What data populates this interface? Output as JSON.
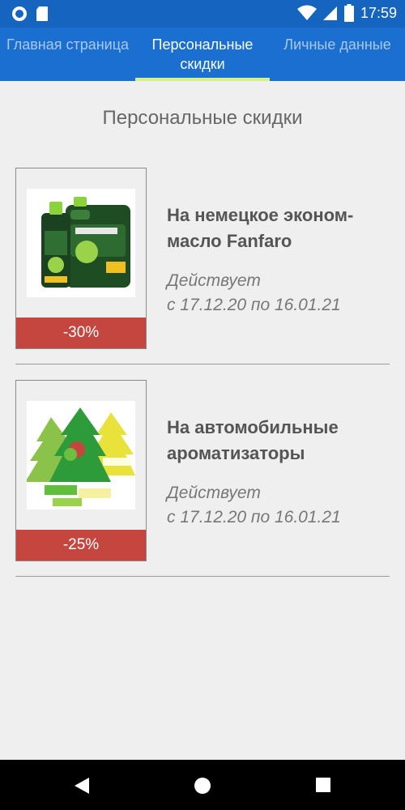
{
  "status_bar": {
    "time": "17:59",
    "icons": [
      "record-icon",
      "sd-card-icon",
      "wifi-icon",
      "signal-icon",
      "battery-icon"
    ]
  },
  "tabs": [
    {
      "label": "Главная страница",
      "active": false
    },
    {
      "label": "Персональные скидки",
      "active": true
    },
    {
      "label": "Личные данные",
      "active": false
    }
  ],
  "page_title": "Персональные скидки",
  "offers": [
    {
      "discount": "-30%",
      "title": "На немецкое эконом-масло Fanfaro",
      "validity_line1": "Действует",
      "validity_line2": "с 17.12.20 по 16.01.21",
      "image": "motor-oil-image"
    },
    {
      "discount": "-25%",
      "title": "На автомобильные ароматизаторы",
      "validity_line1": "Действует",
      "validity_line2": "с 17.12.20 по 16.01.21",
      "image": "air-freshener-image"
    }
  ],
  "colors": {
    "status_bar": "#1565c0",
    "tab_bar": "#1a6fd0",
    "tab_indicator": "#d4f08a",
    "badge": "#c4463f",
    "background": "#efefef"
  },
  "nav": [
    "back-icon",
    "home-icon",
    "recents-icon"
  ]
}
